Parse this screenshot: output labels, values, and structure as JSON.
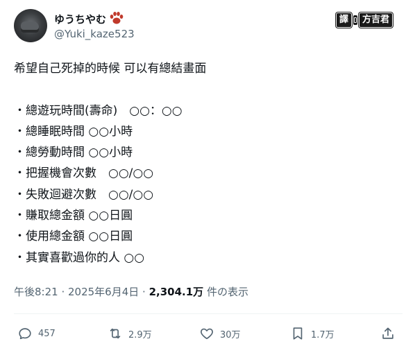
{
  "author": {
    "display_name": "ゆうちやむ",
    "handle": "@Yuki_kaze523",
    "avatar_icon": "avatar-photo",
    "name_icon": "paw-print-icon"
  },
  "badge": {
    "left": "譯",
    "right": "方吉君"
  },
  "tweet": {
    "lines": [
      "希望自己死掉的時候 可以有總結畫面",
      "",
      "・總遊玩時間(壽命)　○○：○○",
      "・總睡眠時間 ○○小時",
      "・總勞動時間 ○○小時",
      "・把握機會次數　○○/○○",
      "・失敗迴避次數　○○/○○",
      "・賺取總金額 ○○日圓",
      "・使用總金額 ○○日圓",
      "・其實喜歡過你的人 ○○"
    ]
  },
  "meta": {
    "time": "午後8:21",
    "separator": " · ",
    "date": "2025年6月4日",
    "views_count": "2,304.1万",
    "views_suffix": " 件の表示"
  },
  "actions": {
    "reply": {
      "icon": "reply-icon",
      "count": "457"
    },
    "retweet": {
      "icon": "retweet-icon",
      "count": "2.9万"
    },
    "like": {
      "icon": "heart-icon",
      "count": "30万"
    },
    "bookmark": {
      "icon": "bookmark-icon",
      "count": "1.7万"
    },
    "share": {
      "icon": "share-icon"
    }
  },
  "colors": {
    "text_primary": "#0f1419",
    "text_secondary": "#536471",
    "divider": "#eff3f4",
    "badge_bg": "#1a1a1a"
  }
}
